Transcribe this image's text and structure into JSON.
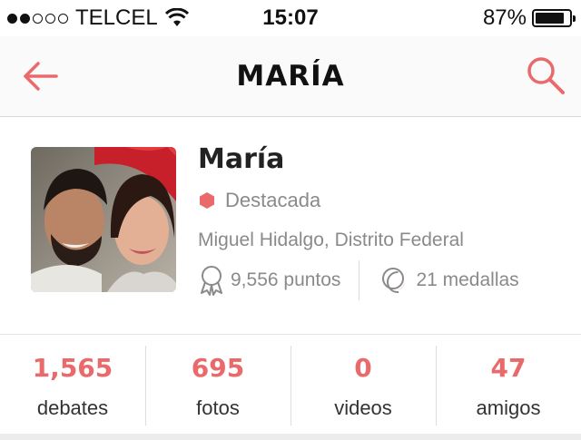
{
  "status_bar": {
    "carrier": "TELCEL",
    "time": "15:07",
    "battery": "87%",
    "battery_level": 0.87,
    "signal_bars": 2,
    "signal_total": 5
  },
  "header": {
    "title": "MARÍA",
    "back_icon": "arrow-left-icon",
    "search_icon": "search-icon",
    "accent_color": "#ea6a6c"
  },
  "profile": {
    "name": "María",
    "badge_label": "Destacada",
    "location": "Miguel Hidalgo, Distrito Federal",
    "points": "9,556 puntos",
    "medals": "21 medallas"
  },
  "counters": [
    {
      "value": "1,565",
      "label": "debates"
    },
    {
      "value": "695",
      "label": "fotos"
    },
    {
      "value": "0",
      "label": "videos"
    },
    {
      "value": "47",
      "label": "amigos"
    }
  ]
}
